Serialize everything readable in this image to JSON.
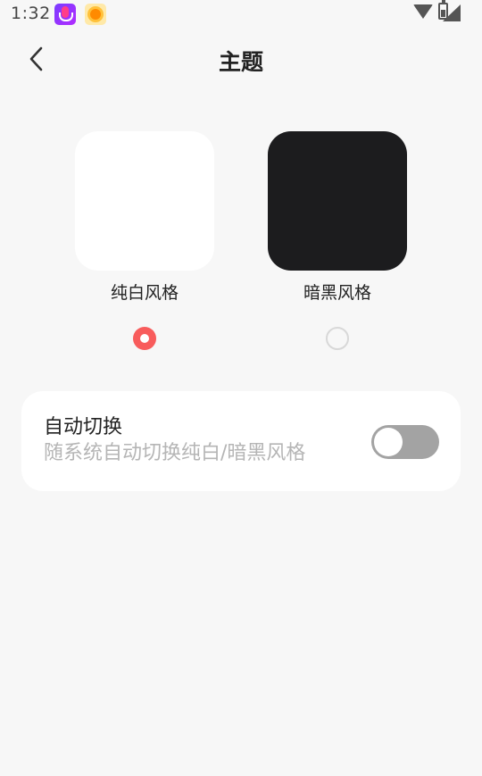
{
  "status_bar": {
    "time": "1:32",
    "icons": [
      "podcast-app-icon",
      "sun-app-icon",
      "wifi-icon",
      "signal-icon",
      "battery-icon"
    ]
  },
  "header": {
    "title": "主题",
    "back_icon": "chevron-left-icon"
  },
  "themes": [
    {
      "label": "纯白风格",
      "swatch_color": "#ffffff",
      "selected": true
    },
    {
      "label": "暗黑风格",
      "swatch_color": "#1c1c1e",
      "selected": false
    }
  ],
  "auto_switch": {
    "title": "自动切换",
    "description": "随系统自动切换纯白/暗黑风格",
    "enabled": false
  },
  "colors": {
    "accent": "#f85c5c",
    "background": "#f7f7f7",
    "toggle_off": "#a3a3a3"
  }
}
